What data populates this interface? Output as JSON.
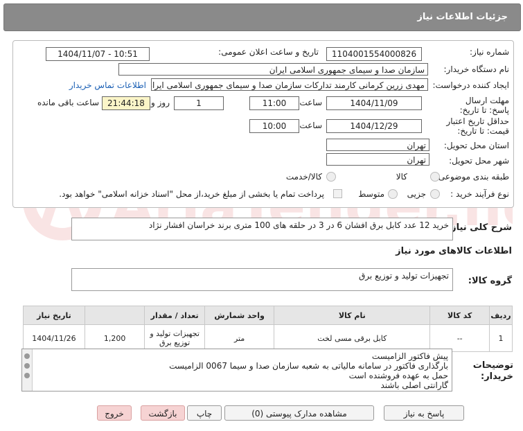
{
  "header": {
    "title": "جزئیات اطلاعات نیاز"
  },
  "form": {
    "need_number_label": "شماره نیاز:",
    "need_number": "1104001554000826",
    "announce_label": "تاریخ و ساعت اعلان عمومی:",
    "announce_value": "1404/11/07 - 10:51",
    "buyer_org_label": "نام دستگاه خریدار:",
    "buyer_org": "سازمان صدا و سیمای جمهوری اسلامی ایران",
    "requester_label": "ایجاد کننده درخواست:",
    "requester": "مهدی زرین کرمانی کارمند تدارکات سازمان صدا و سیمای جمهوری اسلامی ایران",
    "contact_link": "اطلاعات تماس خریدار",
    "deadline_label": "مهلت ارسال پاسخ: تا تاریخ:",
    "deadline_date": "1404/11/09",
    "time_label": "ساعت",
    "deadline_time": "11:00",
    "days_value": "1",
    "days_label": "روز و",
    "remaining_time": "21:44:18",
    "remaining_label": "ساعت باقی مانده",
    "validity_label": "حداقل تاریخ اعتبار قیمت: تا تاریخ:",
    "validity_date": "1404/12/29",
    "validity_time": "10:00",
    "province_label": "استان محل تحویل:",
    "province": "تهران",
    "city_label": "شهر محل تحویل:",
    "city": "تهران",
    "category_label": "طبقه بندی موضوعی:",
    "category_goods": "کالا",
    "category_goods_service": "کالا/خدمت",
    "process_label": "نوع فرآیند خرید :",
    "process_minor": "جزیی",
    "process_medium": "متوسط",
    "payment_note": "پرداخت تمام یا بخشی از مبلغ خرید،از محل \"اسناد خزانه اسلامی\" خواهد بود."
  },
  "summary": {
    "label": "شرح کلی نیاز:",
    "text": "خرید 12 عدد کابل برق افشان  6 در 3  در حلقه های 100 متری برند خراسان افشار نژاد"
  },
  "goods_info": {
    "title": "اطلاعات کالاهای مورد نیاز",
    "group_label": "گروه کالا:",
    "group_value": "تجهیزات تولید و توزیع برق"
  },
  "table": {
    "headers": [
      "ردیف",
      "کد کالا",
      "نام کالا",
      "واحد شمارش",
      "تعداد / مقدار",
      "تاریخ نیاز"
    ],
    "rows": [
      {
        "index": "1",
        "code": "--",
        "name": "کابل برقی مسی لخت",
        "unit": "متر",
        "qty": "1,200",
        "date": "1404/11/26"
      }
    ],
    "extra_col": "تجهیزات تولید و توزیع برق"
  },
  "buyer_notes": {
    "label": "توضیحات خریدار:",
    "lines": [
      "پیش فاکتور الزامیست",
      "بارگذاری فاکتور در سامانه مالیاتی به شعبه سازمان صدا و سیما 0067 الزامیست",
      "حمل به عهده فروشنده است",
      "گارانتی اصلی باشند"
    ]
  },
  "buttons": {
    "reply": "پاسخ به نیاز",
    "attachments": "مشاهده مدارک پیوستی (0)",
    "print": "چاپ",
    "back": "بازگشت",
    "exit": "خروج"
  }
}
